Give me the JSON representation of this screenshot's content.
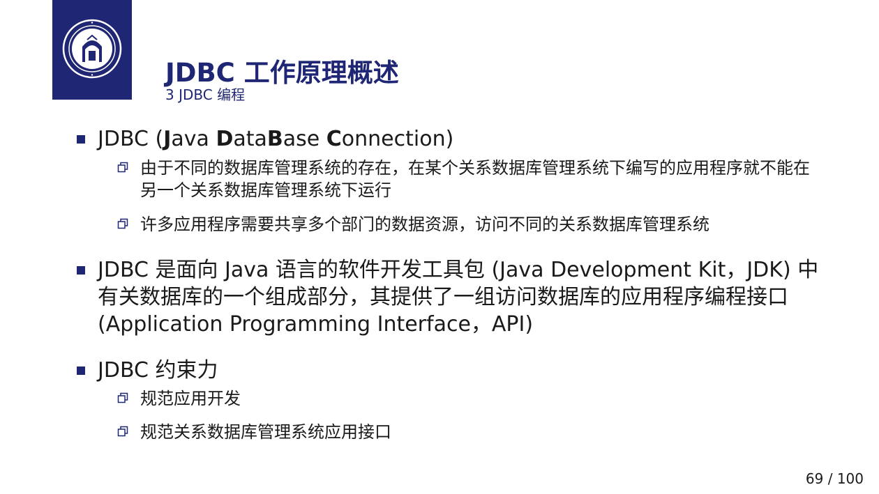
{
  "header": {
    "title": "JDBC 工作原理概述",
    "subtitle": "3 JDBC 编程"
  },
  "bullets": {
    "b1": {
      "pre": "JDBC (",
      "k1": "J",
      "t1": "ava ",
      "k2": "D",
      "t2": "ata",
      "k3": "B",
      "t3": "ase ",
      "k4": "C",
      "t4": "onnection)",
      "sub1": "由于不同的数据库管理系统的存在，在某个关系数据库管理系统下编写的应用程序就不能在另一个关系数据库管理系统下运行",
      "sub2": "许多应用程序需要共享多个部门的数据资源，访问不同的关系数据库管理系统"
    },
    "b2": {
      "text": "JDBC 是面向 Java 语言的软件开发工具包 (Java Development Kit，JDK) 中有关数据库的一个组成部分，其提供了一组访问数据库的应用程序编程接口 (Application Programming Interface，API)"
    },
    "b3": {
      "text": "JDBC 约束力",
      "sub1": "规范应用开发",
      "sub2": "规范关系数据库管理系统应用接口"
    }
  },
  "footer": {
    "page": "69 / 100"
  },
  "colors": {
    "theme": "#1f2674"
  }
}
